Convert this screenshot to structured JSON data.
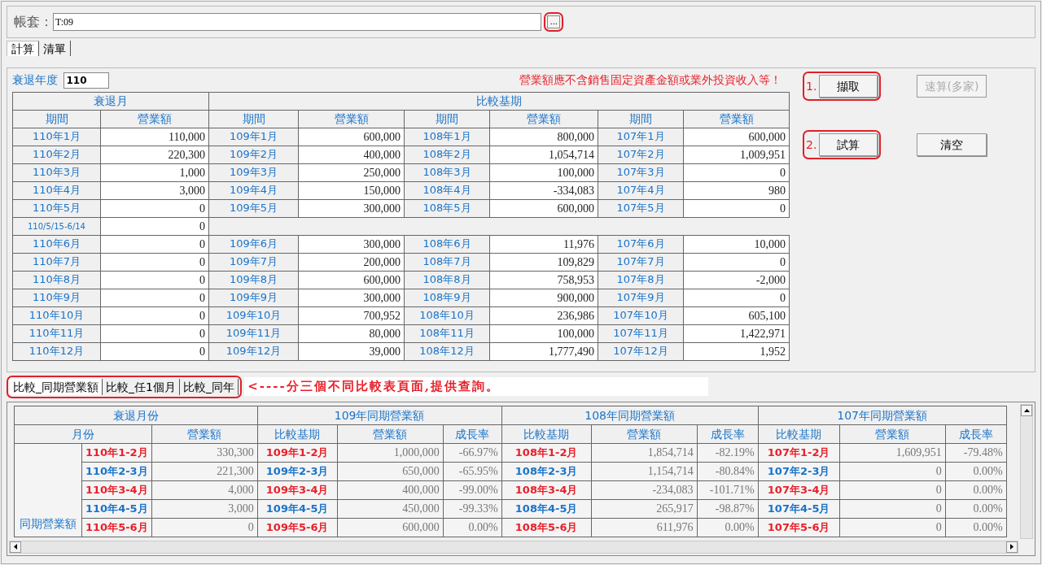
{
  "account": {
    "label": "帳套：",
    "value": "T:09",
    "browse": {
      "label": "...",
      "annotated": true
    }
  },
  "tabs": [
    {
      "label": "計算",
      "selected": true
    },
    {
      "label": "清單",
      "selected": false
    }
  ],
  "year": {
    "label": "衰退年度",
    "value": "110"
  },
  "notice": "營業額應不含銷售固定資產金額或業外投資收入等！",
  "buttons": [
    {
      "label": "擷取",
      "step": "1.",
      "annotated": true,
      "disabled": false
    },
    {
      "label": "速算(多家)",
      "annotated": false,
      "disabled": true
    },
    {
      "label": "試算",
      "step": "2.",
      "annotated": true,
      "disabled": false
    },
    {
      "label": "清空",
      "annotated": false,
      "disabled": false
    }
  ],
  "main_table": {
    "group_headers": [
      "衰退月",
      "比較基期"
    ],
    "columns": [
      "期間",
      "營業額",
      "期間",
      "營業額",
      "期間",
      "營業額",
      "期間",
      "營業額"
    ],
    "rows": [
      {
        "kind": "full",
        "cells": [
          "110年1月",
          "110,000",
          "109年1月",
          "600,000",
          "108年1月",
          "800,000",
          "107年1月",
          "600,000"
        ]
      },
      {
        "kind": "full",
        "cells": [
          "110年2月",
          "220,300",
          "109年2月",
          "400,000",
          "108年2月",
          "1,054,714",
          "107年2月",
          "1,009,951"
        ]
      },
      {
        "kind": "full",
        "cells": [
          "110年3月",
          "1,000",
          "109年3月",
          "250,000",
          "108年3月",
          "100,000",
          "107年3月",
          "0"
        ]
      },
      {
        "kind": "full",
        "cells": [
          "110年4月",
          "3,000",
          "109年4月",
          "150,000",
          "108年4月",
          "-334,083",
          "107年4月",
          "980"
        ]
      },
      {
        "kind": "full",
        "cells": [
          "110年5月",
          "0",
          "109年5月",
          "300,000",
          "108年5月",
          "600,000",
          "107年5月",
          "0"
        ]
      },
      {
        "kind": "partial",
        "cells": [
          "110/5/15-6/14",
          "0"
        ]
      },
      {
        "kind": "full",
        "cells": [
          "110年6月",
          "0",
          "109年6月",
          "300,000",
          "108年6月",
          "11,976",
          "107年6月",
          "10,000"
        ]
      },
      {
        "kind": "full",
        "cells": [
          "110年7月",
          "0",
          "109年7月",
          "200,000",
          "108年7月",
          "109,829",
          "107年7月",
          "0"
        ]
      },
      {
        "kind": "full",
        "cells": [
          "110年8月",
          "0",
          "109年8月",
          "600,000",
          "108年8月",
          "758,953",
          "107年8月",
          "-2,000"
        ]
      },
      {
        "kind": "full",
        "cells": [
          "110年9月",
          "0",
          "109年9月",
          "300,000",
          "108年9月",
          "900,000",
          "107年9月",
          "0"
        ]
      },
      {
        "kind": "full",
        "cells": [
          "110年10月",
          "0",
          "109年10月",
          "700,952",
          "108年10月",
          "236,986",
          "107年10月",
          "605,100"
        ]
      },
      {
        "kind": "full",
        "cells": [
          "110年11月",
          "0",
          "109年11月",
          "80,000",
          "108年11月",
          "100,000",
          "107年11月",
          "1,422,971"
        ]
      },
      {
        "kind": "full",
        "cells": [
          "110年12月",
          "0",
          "109年12月",
          "39,000",
          "108年12月",
          "1,777,490",
          "107年12月",
          "1,952"
        ]
      }
    ]
  },
  "compare_tabs": {
    "annotated": true,
    "items": [
      {
        "label": "比較_同期營業額",
        "selected": true
      },
      {
        "label": "比較_任1個月",
        "selected": false
      },
      {
        "label": "比較_同年",
        "selected": false
      }
    ]
  },
  "compare_note": "<----分三個不同比較表頁面,提供查詢。",
  "compare_table": {
    "group_headers": [
      "衰退月份",
      "109年同期營業額",
      "108年同期營業額",
      "107年同期營業額"
    ],
    "columns": [
      "月份",
      "營業額",
      "比較基期",
      "營業額",
      "成長率",
      "比較基期",
      "營業額",
      "成長率",
      "比較基期",
      "營業額",
      "成長率"
    ],
    "row_group": "同期營業額",
    "rows": [
      {
        "color": "#e8202a",
        "cells": [
          "110年1-2月",
          "330,300",
          "109年1-2月",
          "1,000,000",
          "-66.97%",
          "108年1-2月",
          "1,854,714",
          "-82.19%",
          "107年1-2月",
          "1,609,951",
          "-79.48%"
        ]
      },
      {
        "color": "#1a73c8",
        "cells": [
          "110年2-3月",
          "221,300",
          "109年2-3月",
          "650,000",
          "-65.95%",
          "108年2-3月",
          "1,154,714",
          "-80.84%",
          "107年2-3月",
          "0",
          "0.00%"
        ]
      },
      {
        "color": "#e8202a",
        "cells": [
          "110年3-4月",
          "4,000",
          "109年3-4月",
          "400,000",
          "-99.00%",
          "108年3-4月",
          "-234,083",
          "-101.71%",
          "107年3-4月",
          "0",
          "0.00%"
        ]
      },
      {
        "color": "#1a73c8",
        "cells": [
          "110年4-5月",
          "3,000",
          "109年4-5月",
          "450,000",
          "-99.33%",
          "108年4-5月",
          "265,917",
          "-98.87%",
          "107年4-5月",
          "0",
          "0.00%"
        ]
      },
      {
        "color": "#e8202a",
        "cells": [
          "110年5-6月",
          "0",
          "109年5-6月",
          "600,000",
          "0.00%",
          "108年5-6月",
          "611,976",
          "0.00%",
          "107年5-6月",
          "0",
          "0.00%"
        ]
      }
    ]
  }
}
